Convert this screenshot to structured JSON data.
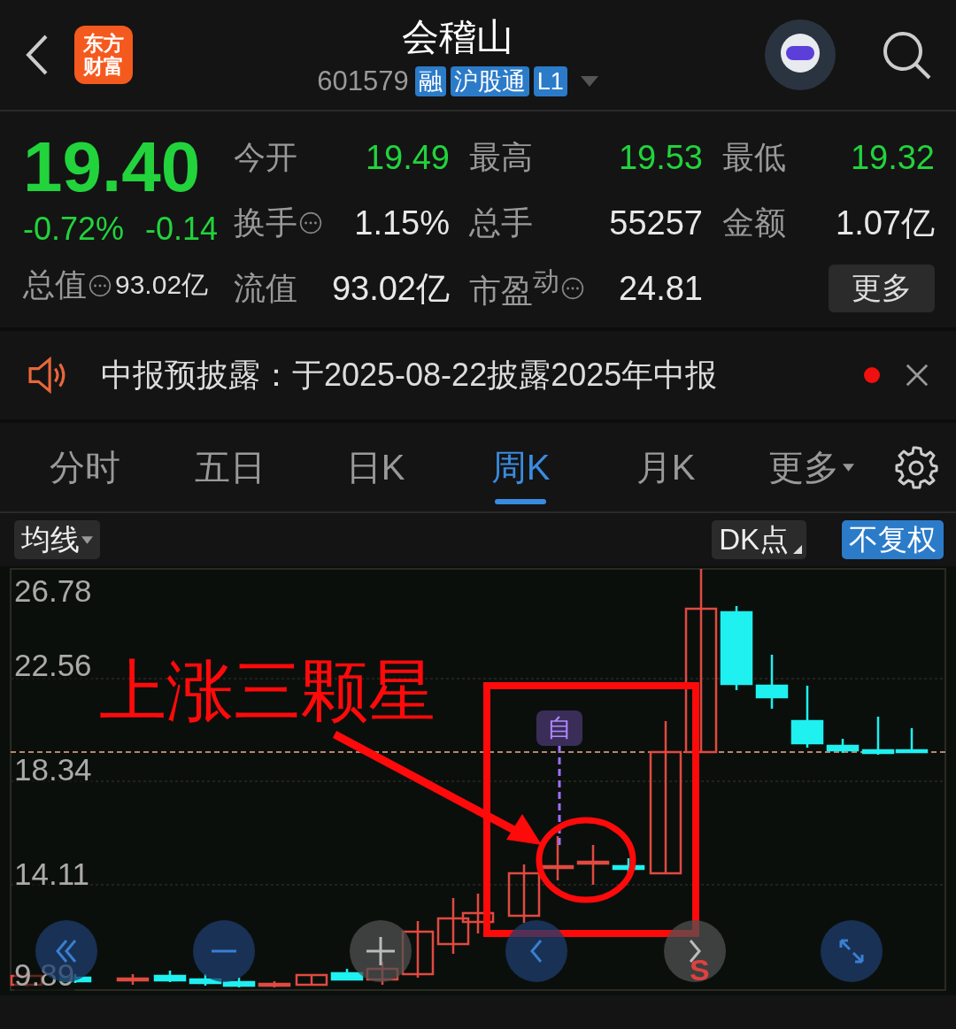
{
  "header": {
    "logo": [
      "东方",
      "财富"
    ],
    "title": "会稽山",
    "code": "601579",
    "badges": [
      "融",
      "沪股通",
      "L1"
    ]
  },
  "quote": {
    "price": "19.40",
    "change_pct": "-0.72%",
    "change": "-0.14",
    "total_value": {
      "label": "总值",
      "value": "93.02亿"
    },
    "stats": [
      {
        "label": "今开",
        "value": "19.49",
        "down": true,
        "kind": "plain"
      },
      {
        "label": "最高",
        "value": "19.53",
        "down": true,
        "kind": "plain"
      },
      {
        "label": "最低",
        "value": "19.32",
        "down": true,
        "kind": "plain"
      },
      {
        "label": "换手",
        "value": "1.15%",
        "down": false,
        "kind": "info"
      },
      {
        "label": "总手",
        "value": "55257",
        "down": false,
        "kind": "plain"
      },
      {
        "label": "金额",
        "value": "1.07亿",
        "down": false,
        "kind": "plain"
      },
      {
        "label": "流值",
        "value": "93.02亿",
        "down": false,
        "kind": "plain"
      },
      {
        "label": "市盈$^{动}$",
        "value": "24.81",
        "down": false,
        "kind": "info"
      }
    ],
    "more_button": "更多"
  },
  "notice": {
    "text": "中报预披露：于2025-08-22披露2025年中报",
    "unread": true
  },
  "tabs": [
    {
      "label": "分时",
      "selected": false,
      "kind": "plain"
    },
    {
      "label": "五日",
      "selected": false,
      "kind": "plain"
    },
    {
      "label": "日K",
      "selected": false,
      "kind": "plain"
    },
    {
      "label": "周K",
      "selected": true,
      "kind": "plain"
    },
    {
      "label": "月K",
      "selected": false,
      "kind": "plain"
    },
    {
      "label": "更多",
      "selected": false,
      "kind": "dropdown"
    }
  ],
  "chart": {
    "indicator_button": "均线",
    "dk_button": "DK点",
    "adjust_button": "不复权",
    "y_labels": [
      "26.78",
      "22.56",
      "18.34",
      "14.11",
      "9.89"
    ],
    "marker": "自",
    "annotation": "上涨三颗星",
    "sell_marker": "S"
  }
}
